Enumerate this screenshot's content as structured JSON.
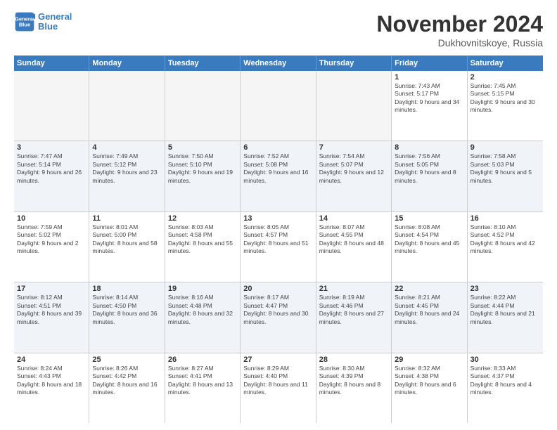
{
  "logo": {
    "line1": "General",
    "line2": "Blue"
  },
  "title": "November 2024",
  "subtitle": "Dukhovnitskoye, Russia",
  "header_days": [
    "Sunday",
    "Monday",
    "Tuesday",
    "Wednesday",
    "Thursday",
    "Friday",
    "Saturday"
  ],
  "rows": [
    [
      {
        "day": "",
        "sunrise": "",
        "sunset": "",
        "daylight": "",
        "empty": true
      },
      {
        "day": "",
        "sunrise": "",
        "sunset": "",
        "daylight": "",
        "empty": true
      },
      {
        "day": "",
        "sunrise": "",
        "sunset": "",
        "daylight": "",
        "empty": true
      },
      {
        "day": "",
        "sunrise": "",
        "sunset": "",
        "daylight": "",
        "empty": true
      },
      {
        "day": "",
        "sunrise": "",
        "sunset": "",
        "daylight": "",
        "empty": true
      },
      {
        "day": "1",
        "sunrise": "Sunrise: 7:43 AM",
        "sunset": "Sunset: 5:17 PM",
        "daylight": "Daylight: 9 hours and 34 minutes.",
        "empty": false
      },
      {
        "day": "2",
        "sunrise": "Sunrise: 7:45 AM",
        "sunset": "Sunset: 5:15 PM",
        "daylight": "Daylight: 9 hours and 30 minutes.",
        "empty": false
      }
    ],
    [
      {
        "day": "3",
        "sunrise": "Sunrise: 7:47 AM",
        "sunset": "Sunset: 5:14 PM",
        "daylight": "Daylight: 9 hours and 26 minutes.",
        "empty": false
      },
      {
        "day": "4",
        "sunrise": "Sunrise: 7:49 AM",
        "sunset": "Sunset: 5:12 PM",
        "daylight": "Daylight: 9 hours and 23 minutes.",
        "empty": false
      },
      {
        "day": "5",
        "sunrise": "Sunrise: 7:50 AM",
        "sunset": "Sunset: 5:10 PM",
        "daylight": "Daylight: 9 hours and 19 minutes.",
        "empty": false
      },
      {
        "day": "6",
        "sunrise": "Sunrise: 7:52 AM",
        "sunset": "Sunset: 5:08 PM",
        "daylight": "Daylight: 9 hours and 16 minutes.",
        "empty": false
      },
      {
        "day": "7",
        "sunrise": "Sunrise: 7:54 AM",
        "sunset": "Sunset: 5:07 PM",
        "daylight": "Daylight: 9 hours and 12 minutes.",
        "empty": false
      },
      {
        "day": "8",
        "sunrise": "Sunrise: 7:56 AM",
        "sunset": "Sunset: 5:05 PM",
        "daylight": "Daylight: 9 hours and 8 minutes.",
        "empty": false
      },
      {
        "day": "9",
        "sunrise": "Sunrise: 7:58 AM",
        "sunset": "Sunset: 5:03 PM",
        "daylight": "Daylight: 9 hours and 5 minutes.",
        "empty": false
      }
    ],
    [
      {
        "day": "10",
        "sunrise": "Sunrise: 7:59 AM",
        "sunset": "Sunset: 5:02 PM",
        "daylight": "Daylight: 9 hours and 2 minutes.",
        "empty": false
      },
      {
        "day": "11",
        "sunrise": "Sunrise: 8:01 AM",
        "sunset": "Sunset: 5:00 PM",
        "daylight": "Daylight: 8 hours and 58 minutes.",
        "empty": false
      },
      {
        "day": "12",
        "sunrise": "Sunrise: 8:03 AM",
        "sunset": "Sunset: 4:58 PM",
        "daylight": "Daylight: 8 hours and 55 minutes.",
        "empty": false
      },
      {
        "day": "13",
        "sunrise": "Sunrise: 8:05 AM",
        "sunset": "Sunset: 4:57 PM",
        "daylight": "Daylight: 8 hours and 51 minutes.",
        "empty": false
      },
      {
        "day": "14",
        "sunrise": "Sunrise: 8:07 AM",
        "sunset": "Sunset: 4:55 PM",
        "daylight": "Daylight: 8 hours and 48 minutes.",
        "empty": false
      },
      {
        "day": "15",
        "sunrise": "Sunrise: 8:08 AM",
        "sunset": "Sunset: 4:54 PM",
        "daylight": "Daylight: 8 hours and 45 minutes.",
        "empty": false
      },
      {
        "day": "16",
        "sunrise": "Sunrise: 8:10 AM",
        "sunset": "Sunset: 4:52 PM",
        "daylight": "Daylight: 8 hours and 42 minutes.",
        "empty": false
      }
    ],
    [
      {
        "day": "17",
        "sunrise": "Sunrise: 8:12 AM",
        "sunset": "Sunset: 4:51 PM",
        "daylight": "Daylight: 8 hours and 39 minutes.",
        "empty": false
      },
      {
        "day": "18",
        "sunrise": "Sunrise: 8:14 AM",
        "sunset": "Sunset: 4:50 PM",
        "daylight": "Daylight: 8 hours and 36 minutes.",
        "empty": false
      },
      {
        "day": "19",
        "sunrise": "Sunrise: 8:16 AM",
        "sunset": "Sunset: 4:48 PM",
        "daylight": "Daylight: 8 hours and 32 minutes.",
        "empty": false
      },
      {
        "day": "20",
        "sunrise": "Sunrise: 8:17 AM",
        "sunset": "Sunset: 4:47 PM",
        "daylight": "Daylight: 8 hours and 30 minutes.",
        "empty": false
      },
      {
        "day": "21",
        "sunrise": "Sunrise: 8:19 AM",
        "sunset": "Sunset: 4:46 PM",
        "daylight": "Daylight: 8 hours and 27 minutes.",
        "empty": false
      },
      {
        "day": "22",
        "sunrise": "Sunrise: 8:21 AM",
        "sunset": "Sunset: 4:45 PM",
        "daylight": "Daylight: 8 hours and 24 minutes.",
        "empty": false
      },
      {
        "day": "23",
        "sunrise": "Sunrise: 8:22 AM",
        "sunset": "Sunset: 4:44 PM",
        "daylight": "Daylight: 8 hours and 21 minutes.",
        "empty": false
      }
    ],
    [
      {
        "day": "24",
        "sunrise": "Sunrise: 8:24 AM",
        "sunset": "Sunset: 4:43 PM",
        "daylight": "Daylight: 8 hours and 18 minutes.",
        "empty": false
      },
      {
        "day": "25",
        "sunrise": "Sunrise: 8:26 AM",
        "sunset": "Sunset: 4:42 PM",
        "daylight": "Daylight: 8 hours and 16 minutes.",
        "empty": false
      },
      {
        "day": "26",
        "sunrise": "Sunrise: 8:27 AM",
        "sunset": "Sunset: 4:41 PM",
        "daylight": "Daylight: 8 hours and 13 minutes.",
        "empty": false
      },
      {
        "day": "27",
        "sunrise": "Sunrise: 8:29 AM",
        "sunset": "Sunset: 4:40 PM",
        "daylight": "Daylight: 8 hours and 11 minutes.",
        "empty": false
      },
      {
        "day": "28",
        "sunrise": "Sunrise: 8:30 AM",
        "sunset": "Sunset: 4:39 PM",
        "daylight": "Daylight: 8 hours and 8 minutes.",
        "empty": false
      },
      {
        "day": "29",
        "sunrise": "Sunrise: 8:32 AM",
        "sunset": "Sunset: 4:38 PM",
        "daylight": "Daylight: 8 hours and 6 minutes.",
        "empty": false
      },
      {
        "day": "30",
        "sunrise": "Sunrise: 8:33 AM",
        "sunset": "Sunset: 4:37 PM",
        "daylight": "Daylight: 8 hours and 4 minutes.",
        "empty": false
      }
    ]
  ]
}
